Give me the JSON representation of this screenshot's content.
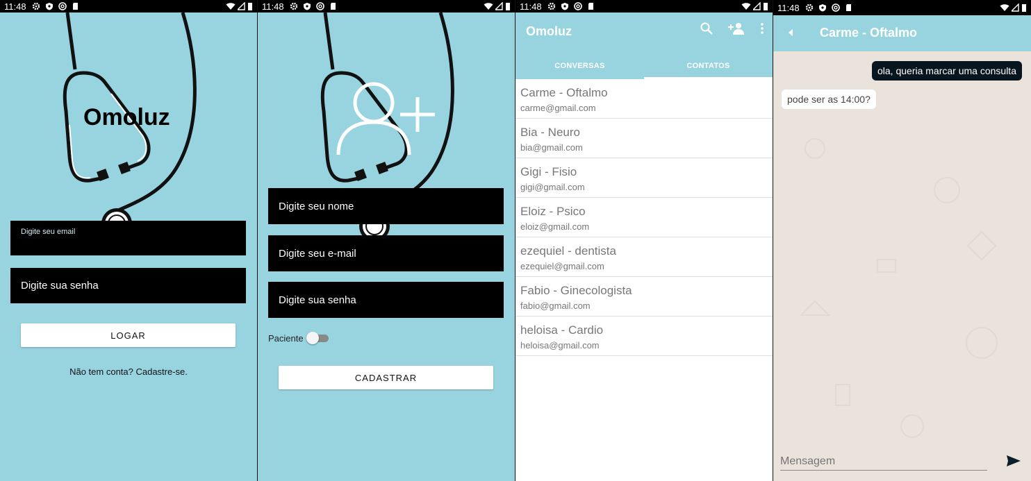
{
  "status_bar": {
    "time": "11:48"
  },
  "login": {
    "logo": "Omoluz",
    "email_label": "Digite seu email",
    "password_label": "Digite sua senha",
    "login_button": "LOGAR",
    "signup_link": "Não tem conta? Cadastre-se."
  },
  "register": {
    "name_label": "Digite seu nome",
    "email_label": "Digite seu e-mail",
    "password_label": "Digite sua senha",
    "patient_label": "Paciente",
    "patient_toggle": "off",
    "register_button": "CADASTRAR"
  },
  "contacts_screen": {
    "title": "Omoluz",
    "tabs": [
      "CONVERSAS",
      "CONTATOS"
    ],
    "active_tab": "CONTATOS",
    "contacts": [
      {
        "name": "Carme - Oftalmo",
        "email": "carme@gmail.com"
      },
      {
        "name": "Bia - Neuro",
        "email": "bia@gmail.com"
      },
      {
        "name": "Gigi - Fisio",
        "email": "gigi@gmail.com"
      },
      {
        "name": "Eloiz - Psico",
        "email": "eloiz@gmail.com"
      },
      {
        "name": "ezequiel - dentista",
        "email": "ezequiel@gmail.com"
      },
      {
        "name": "Fabio - Ginecologista",
        "email": "fabio@gmail.com"
      },
      {
        "name": "heloisa - Cardio",
        "email": "heloisa@gmail.com"
      }
    ]
  },
  "chat": {
    "title": "Carme - Oftalmo",
    "messages": [
      {
        "direction": "out",
        "text": "ola, queria marcar uma consulta"
      },
      {
        "direction": "in",
        "text": "pode ser as 14:00?"
      }
    ],
    "input_placeholder": "Mensagem"
  },
  "colors": {
    "primary": "#98d4e0",
    "field_bg": "#000000",
    "outgoing_bubble": "#06151e",
    "chat_bg": "#e9e3dc"
  }
}
